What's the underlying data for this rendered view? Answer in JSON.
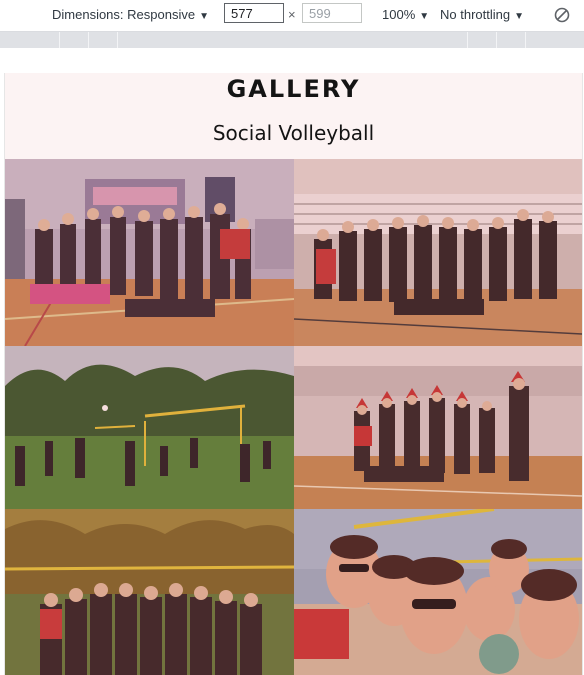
{
  "devtools": {
    "dimensions_label": "Dimensions: Responsive",
    "width_value": "577",
    "times_symbol": "×",
    "height_placeholder": "599",
    "zoom": "100%",
    "throttling": "No throttling",
    "caret": "▼"
  },
  "page": {
    "title": "GALLERY",
    "subtitle": "Social Volleyball"
  },
  "gallery": {
    "photos": [
      {
        "subject": "indoor group photo sports hall"
      },
      {
        "subject": "indoor team photo near net"
      },
      {
        "subject": "outdoor volleyball on grass"
      },
      {
        "subject": "christmas party group indoors"
      },
      {
        "subject": "autumn group photo outdoors"
      },
      {
        "subject": "beach volleyball selfie"
      }
    ]
  },
  "colors": {
    "hero_background": "#fcf3f3",
    "photo_tint": "#cd4646"
  }
}
